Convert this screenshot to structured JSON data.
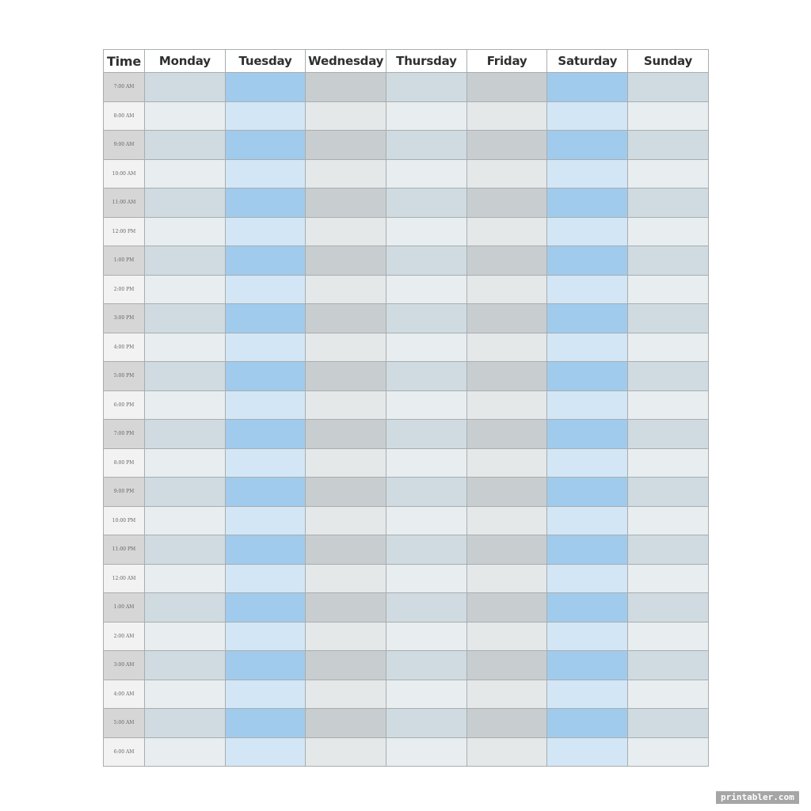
{
  "header": {
    "time_label": "Time",
    "days": [
      "Monday",
      "Tuesday",
      "Wednesday",
      "Thursday",
      "Friday",
      "Saturday",
      "Sunday"
    ]
  },
  "rows": [
    {
      "time": "7:00 AM"
    },
    {
      "time": "8:00 AM"
    },
    {
      "time": "9:00 AM"
    },
    {
      "time": "10:00 AM"
    },
    {
      "time": "11:00 AM"
    },
    {
      "time": "12:00 PM"
    },
    {
      "time": "1:00 PM"
    },
    {
      "time": "2:00 PM"
    },
    {
      "time": "3:00 PM"
    },
    {
      "time": "4:00 PM"
    },
    {
      "time": "5:00 PM"
    },
    {
      "time": "6:00 PM"
    },
    {
      "time": "7:00 PM"
    },
    {
      "time": "8:00 PM"
    },
    {
      "time": "9:00 PM"
    },
    {
      "time": "10:00 PM"
    },
    {
      "time": "11:00 PM"
    },
    {
      "time": "12:00 AM"
    },
    {
      "time": "1:00 AM"
    },
    {
      "time": "2:00 AM"
    },
    {
      "time": "3:00 AM"
    },
    {
      "time": "4:00 AM"
    },
    {
      "time": "5:00 AM"
    },
    {
      "time": "6:00 AM"
    }
  ],
  "watermark": "printabler.com"
}
